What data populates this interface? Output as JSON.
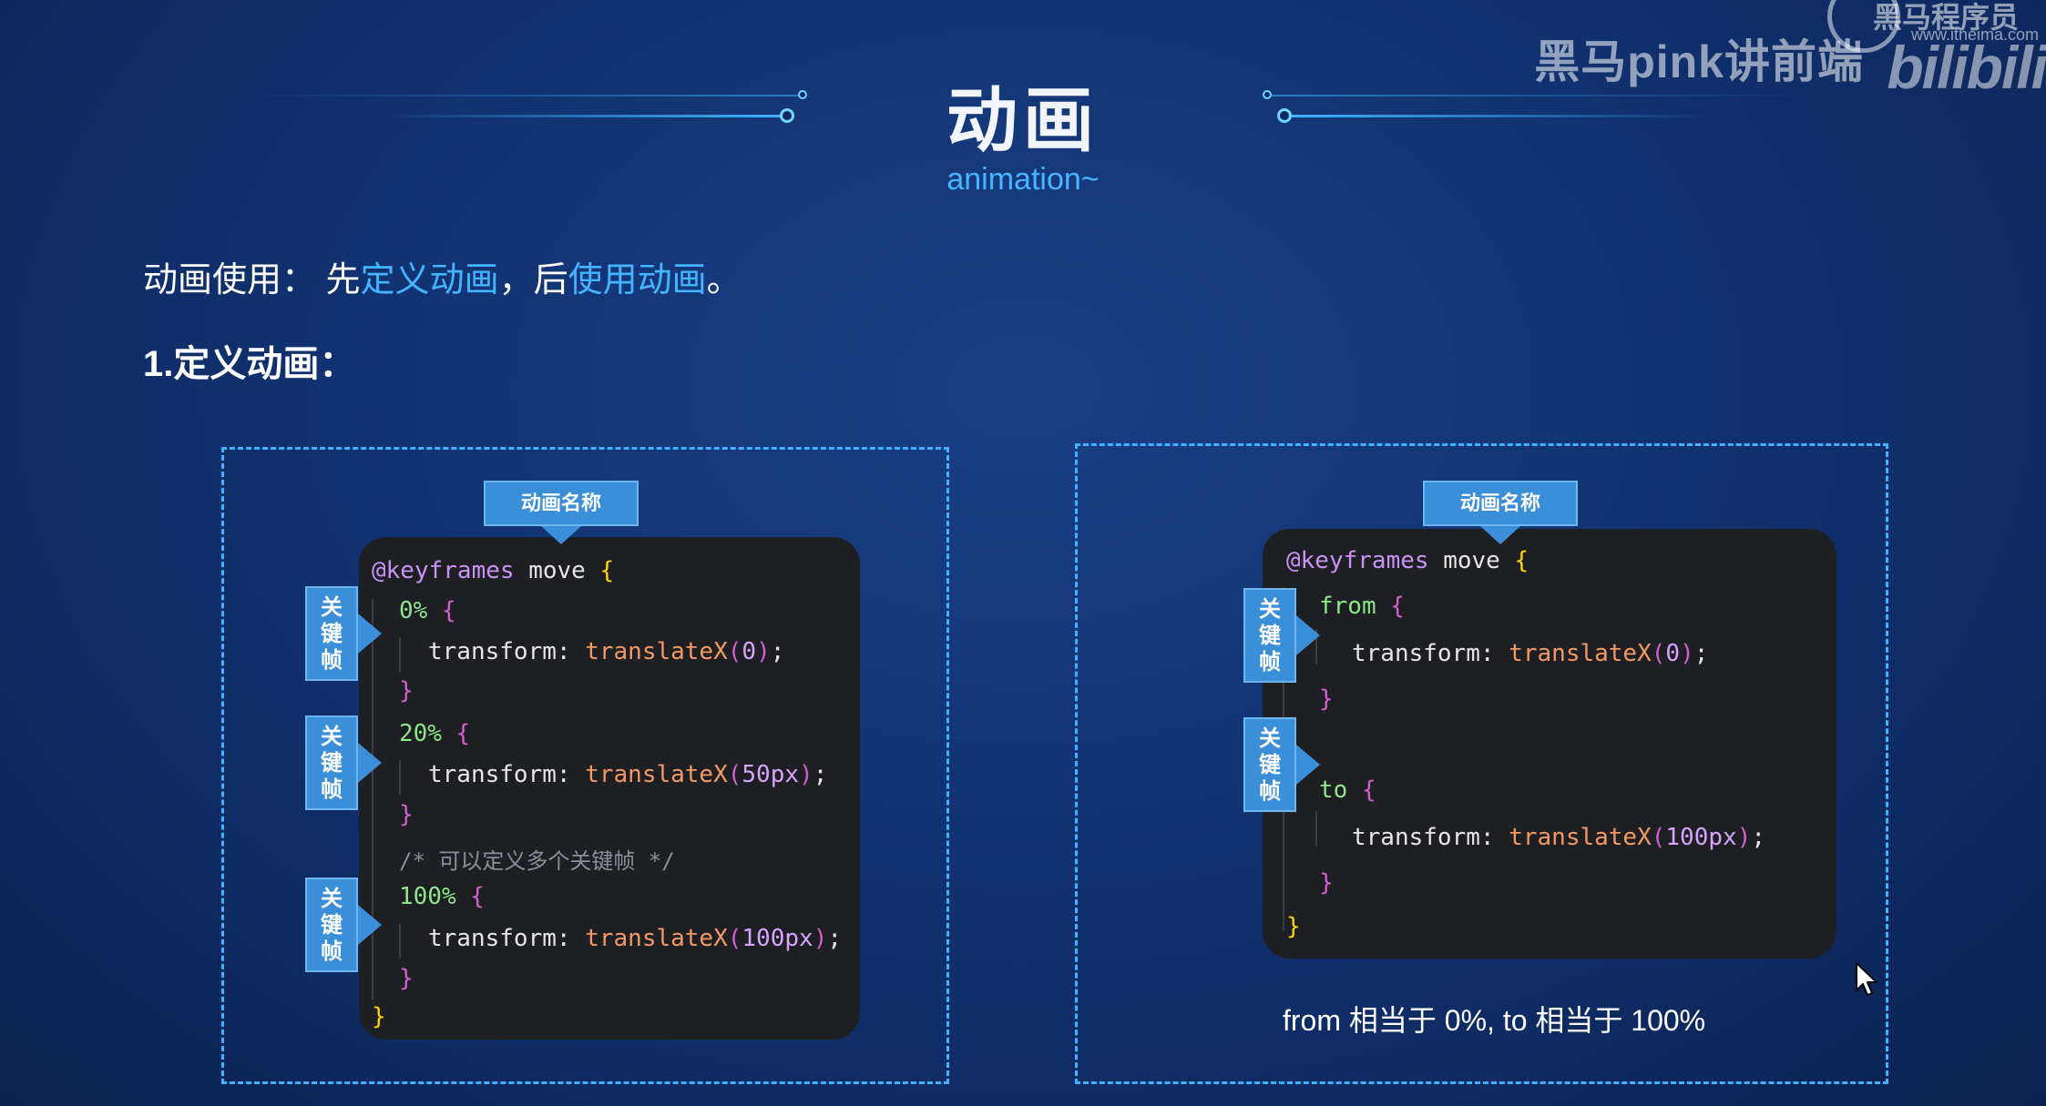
{
  "header": {
    "title": "动画",
    "subtitle": "animation~"
  },
  "watermark": {
    "author": "黑马pink讲前端",
    "brand": "黑马程序员",
    "site": "www.itheima.com",
    "logo": "bilibili"
  },
  "intro": {
    "prefix": "动画使用：  先",
    "define": "定义动画",
    "middle": "，后",
    "use": "使用动画",
    "suffix": "。"
  },
  "section_title": "1.定义动画：",
  "labels": {
    "animation_name": "动画名称",
    "keyframe": [
      "关",
      "键",
      "帧"
    ]
  },
  "left_code": {
    "at_rule": "@keyframes",
    "name": "move",
    "open": "{",
    "close": "}",
    "step1": "0%",
    "step2": "20%",
    "step3": "100%",
    "prop": "transform:",
    "fn": "translateX",
    "v1": "0",
    "v2": "50px",
    "v3": "100px",
    "comment": "/* 可以定义多个关键帧 */"
  },
  "right_code": {
    "at_rule": "@keyframes",
    "name": "move",
    "from": "from",
    "to": "to",
    "prop": "transform:",
    "fn": "translateX",
    "v1": "0",
    "v2": "100px"
  },
  "caption": "from 相当于 0%, to 相当于 100%",
  "colors": {
    "accent": "#45b4ff",
    "label_bg": "#3b8fd8",
    "code_bg": "#1e1f22"
  }
}
